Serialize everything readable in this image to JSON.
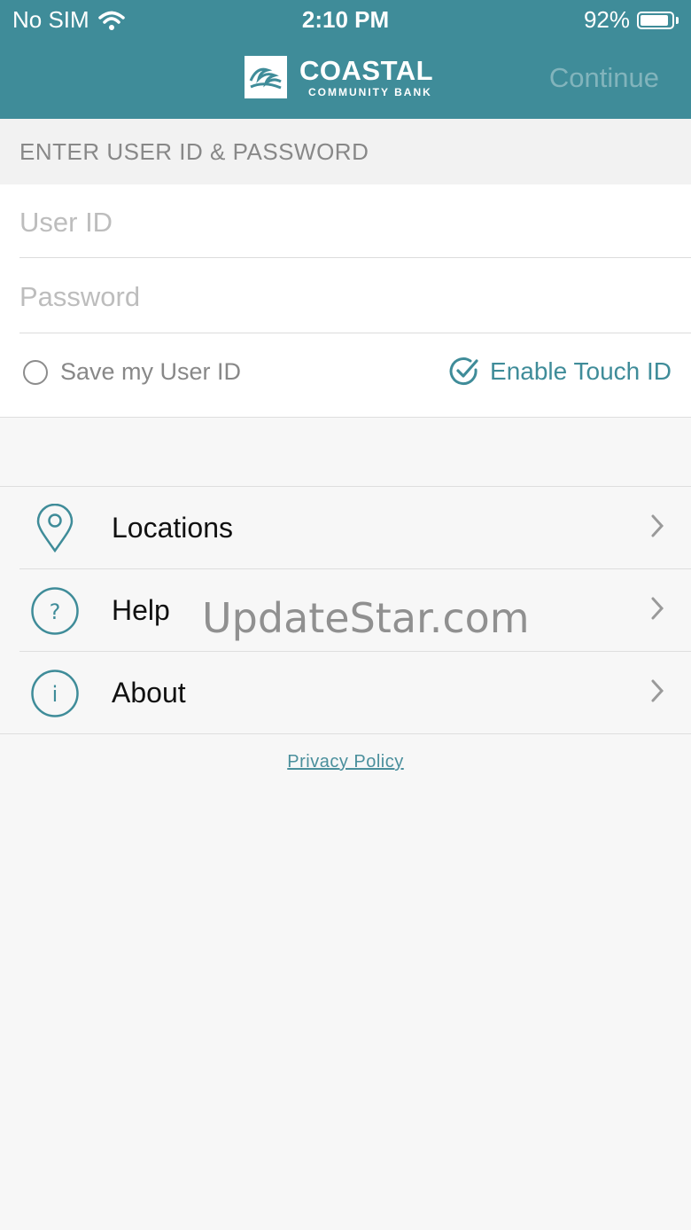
{
  "status_bar": {
    "carrier": "No SIM",
    "time": "2:10 PM",
    "battery": "92%",
    "battery_level": 0.92
  },
  "header": {
    "brand_name": "COASTAL",
    "brand_sub": "COMMUNITY BANK",
    "continue_label": "Continue"
  },
  "login": {
    "section_title": "ENTER USER ID & PASSWORD",
    "user_placeholder": "User ID",
    "password_placeholder": "Password",
    "save_user_label": "Save my User ID",
    "touch_id_label": "Enable Touch ID"
  },
  "menu": {
    "items": [
      {
        "label": "Locations",
        "icon": "location-pin-icon"
      },
      {
        "label": "Help",
        "icon": "help-icon"
      },
      {
        "label": "About",
        "icon": "info-icon"
      }
    ]
  },
  "footer": {
    "privacy_label": "Privacy Policy"
  },
  "watermark": "UpdateStar.com",
  "colors": {
    "brand": "#3f8c99",
    "background": "#f7f7f7"
  }
}
